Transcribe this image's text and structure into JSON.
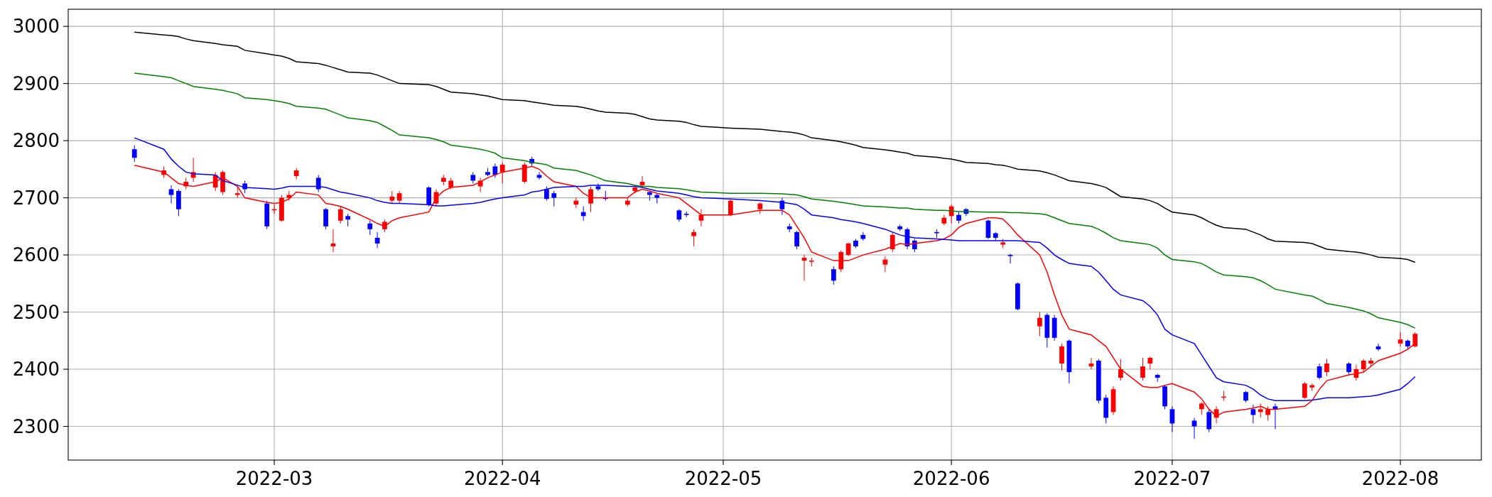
{
  "chart_data": {
    "type": "candlestick",
    "grid": true,
    "xlim": [
      "2022-02-01",
      "2022-08-12"
    ],
    "ylim": [
      2241,
      3030
    ],
    "xticks": [
      {
        "value": "2022-03-01",
        "label": "2022-03"
      },
      {
        "value": "2022-04-01",
        "label": "2022-04"
      },
      {
        "value": "2022-05-01",
        "label": "2022-05"
      },
      {
        "value": "2022-06-01",
        "label": "2022-06"
      },
      {
        "value": "2022-07-01",
        "label": "2022-07"
      },
      {
        "value": "2022-08-01",
        "label": "2022-08"
      }
    ],
    "yticks": [
      2300,
      2400,
      2500,
      2600,
      2700,
      2800,
      2900,
      3000
    ],
    "x": [
      "2022-02-10",
      "2022-02-14",
      "2022-02-15",
      "2022-02-16",
      "2022-02-17",
      "2022-02-18",
      "2022-02-21",
      "2022-02-22",
      "2022-02-24",
      "2022-02-25",
      "2022-02-28",
      "2022-03-01",
      "2022-03-02",
      "2022-03-03",
      "2022-03-04",
      "2022-03-07",
      "2022-03-08",
      "2022-03-09",
      "2022-03-10",
      "2022-03-11",
      "2022-03-14",
      "2022-03-15",
      "2022-03-16",
      "2022-03-17",
      "2022-03-18",
      "2022-03-22",
      "2022-03-23",
      "2022-03-24",
      "2022-03-25",
      "2022-03-28",
      "2022-03-29",
      "2022-03-30",
      "2022-03-31",
      "2022-04-01",
      "2022-04-04",
      "2022-04-05",
      "2022-04-06",
      "2022-04-07",
      "2022-04-08",
      "2022-04-11",
      "2022-04-12",
      "2022-04-13",
      "2022-04-14",
      "2022-04-15",
      "2022-04-18",
      "2022-04-19",
      "2022-04-20",
      "2022-04-21",
      "2022-04-22",
      "2022-04-25",
      "2022-04-26",
      "2022-04-27",
      "2022-04-28",
      "2022-05-02",
      "2022-05-06",
      "2022-05-09",
      "2022-05-10",
      "2022-05-11",
      "2022-05-12",
      "2022-05-13",
      "2022-05-16",
      "2022-05-17",
      "2022-05-18",
      "2022-05-19",
      "2022-05-20",
      "2022-05-23",
      "2022-05-24",
      "2022-05-25",
      "2022-05-26",
      "2022-05-27",
      "2022-05-30",
      "2022-05-31",
      "2022-06-01",
      "2022-06-02",
      "2022-06-03",
      "2022-06-06",
      "2022-06-07",
      "2022-06-08",
      "2022-06-09",
      "2022-06-10",
      "2022-06-13",
      "2022-06-14",
      "2022-06-15",
      "2022-06-16",
      "2022-06-17",
      "2022-06-20",
      "2022-06-21",
      "2022-06-22",
      "2022-06-23",
      "2022-06-24",
      "2022-06-27",
      "2022-06-28",
      "2022-06-29",
      "2022-06-30",
      "2022-07-01",
      "2022-07-04",
      "2022-07-05",
      "2022-07-06",
      "2022-07-07",
      "2022-07-08",
      "2022-07-11",
      "2022-07-12",
      "2022-07-13",
      "2022-07-14",
      "2022-07-15",
      "2022-07-19",
      "2022-07-20",
      "2022-07-21",
      "2022-07-22",
      "2022-07-25",
      "2022-07-26",
      "2022-07-27",
      "2022-07-28",
      "2022-07-29",
      "2022-08-01",
      "2022-08-02",
      "2022-08-03"
    ],
    "ohlc": [
      [
        2785,
        2792,
        2763,
        2770
      ],
      [
        2740,
        2755,
        2735,
        2748
      ],
      [
        2715,
        2722,
        2690,
        2705
      ],
      [
        2712,
        2715,
        2668,
        2680
      ],
      [
        2720,
        2735,
        2715,
        2728
      ],
      [
        2735,
        2770,
        2728,
        2745
      ],
      [
        2718,
        2745,
        2712,
        2740
      ],
      [
        2710,
        2748,
        2705,
        2745
      ],
      [
        2705,
        2718,
        2700,
        2708
      ],
      [
        2725,
        2730,
        2708,
        2715
      ],
      [
        2690,
        2695,
        2645,
        2650
      ],
      [
        2678,
        2688,
        2672,
        2680
      ],
      [
        2660,
        2705,
        2658,
        2700
      ],
      [
        2700,
        2712,
        2695,
        2705
      ],
      [
        2738,
        2752,
        2732,
        2748
      ],
      [
        2735,
        2740,
        2710,
        2715
      ],
      [
        2680,
        2682,
        2645,
        2650
      ],
      [
        2615,
        2645,
        2605,
        2620
      ],
      [
        2660,
        2685,
        2655,
        2680
      ],
      [
        2668,
        2672,
        2650,
        2662
      ],
      [
        2655,
        2660,
        2635,
        2645
      ],
      [
        2630,
        2640,
        2612,
        2620
      ],
      [
        2645,
        2662,
        2640,
        2658
      ],
      [
        2695,
        2712,
        2690,
        2702
      ],
      [
        2695,
        2712,
        2690,
        2708
      ],
      [
        2718,
        2720,
        2685,
        2688
      ],
      [
        2690,
        2715,
        2686,
        2710
      ],
      [
        2728,
        2740,
        2722,
        2735
      ],
      [
        2718,
        2735,
        2715,
        2730
      ],
      [
        2740,
        2745,
        2725,
        2730
      ],
      [
        2720,
        2735,
        2710,
        2730
      ],
      [
        2745,
        2752,
        2738,
        2740
      ],
      [
        2755,
        2760,
        2735,
        2740
      ],
      [
        2745,
        2762,
        2725,
        2758
      ],
      [
        2728,
        2762,
        2725,
        2758
      ],
      [
        2768,
        2772,
        2755,
        2760
      ],
      [
        2740,
        2745,
        2732,
        2735
      ],
      [
        2715,
        2720,
        2695,
        2698
      ],
      [
        2708,
        2712,
        2685,
        2700
      ],
      [
        2688,
        2700,
        2682,
        2695
      ],
      [
        2675,
        2685,
        2660,
        2668
      ],
      [
        2690,
        2720,
        2675,
        2715
      ],
      [
        2720,
        2725,
        2712,
        2715
      ],
      [
        2700,
        2712,
        2695,
        2698
      ],
      [
        2688,
        2700,
        2685,
        2695
      ],
      [
        2712,
        2722,
        2708,
        2718
      ],
      [
        2722,
        2738,
        2720,
        2728
      ],
      [
        2710,
        2712,
        2695,
        2705
      ],
      [
        2705,
        2708,
        2690,
        2700
      ],
      [
        2678,
        2680,
        2658,
        2662
      ],
      [
        2672,
        2676,
        2666,
        2670
      ],
      [
        2633,
        2645,
        2615,
        2640
      ],
      [
        2660,
        2680,
        2650,
        2670
      ],
      [
        2670,
        2698,
        2668,
        2695
      ],
      [
        2680,
        2692,
        2672,
        2690
      ],
      [
        2695,
        2700,
        2670,
        2680
      ],
      [
        2650,
        2655,
        2640,
        2645
      ],
      [
        2640,
        2642,
        2610,
        2615
      ],
      [
        2590,
        2600,
        2555,
        2595
      ],
      [
        2588,
        2595,
        2580,
        2590
      ],
      [
        2575,
        2580,
        2548,
        2555
      ],
      [
        2575,
        2608,
        2570,
        2605
      ],
      [
        2600,
        2622,
        2598,
        2620
      ],
      [
        2625,
        2628,
        2612,
        2615
      ],
      [
        2635,
        2640,
        2625,
        2628
      ],
      [
        2583,
        2598,
        2570,
        2592
      ],
      [
        2610,
        2640,
        2605,
        2635
      ],
      [
        2650,
        2653,
        2642,
        2645
      ],
      [
        2645,
        2648,
        2610,
        2615
      ],
      [
        2625,
        2628,
        2605,
        2610
      ],
      [
        2640,
        2645,
        2630,
        2638
      ],
      [
        2655,
        2670,
        2652,
        2665
      ],
      [
        2668,
        2688,
        2655,
        2685
      ],
      [
        2670,
        2675,
        2655,
        2660
      ],
      [
        2680,
        2682,
        2668,
        2672
      ],
      [
        2660,
        2662,
        2628,
        2630
      ],
      [
        2638,
        2640,
        2625,
        2630
      ],
      [
        2618,
        2628,
        2612,
        2622
      ],
      [
        2600,
        2602,
        2585,
        2598
      ],
      [
        2550,
        2552,
        2503,
        2505
      ],
      [
        2475,
        2500,
        2458,
        2490
      ],
      [
        2495,
        2498,
        2438,
        2455
      ],
      [
        2490,
        2495,
        2450,
        2455
      ],
      [
        2410,
        2445,
        2398,
        2440
      ],
      [
        2450,
        2452,
        2375,
        2395
      ],
      [
        2405,
        2420,
        2400,
        2410
      ],
      [
        2415,
        2418,
        2340,
        2345
      ],
      [
        2350,
        2355,
        2305,
        2315
      ],
      [
        2325,
        2370,
        2320,
        2365
      ],
      [
        2385,
        2418,
        2380,
        2400
      ],
      [
        2385,
        2420,
        2380,
        2405
      ],
      [
        2410,
        2422,
        2400,
        2420
      ],
      [
        2390,
        2392,
        2378,
        2385
      ],
      [
        2370,
        2372,
        2330,
        2335
      ],
      [
        2330,
        2335,
        2290,
        2305
      ],
      [
        2310,
        2315,
        2278,
        2300
      ],
      [
        2330,
        2342,
        2320,
        2340
      ],
      [
        2325,
        2330,
        2290,
        2295
      ],
      [
        2315,
        2335,
        2305,
        2330
      ],
      [
        2350,
        2362,
        2345,
        2352
      ],
      [
        2360,
        2362,
        2342,
        2345
      ],
      [
        2330,
        2338,
        2305,
        2320
      ],
      [
        2325,
        2340,
        2315,
        2330
      ],
      [
        2320,
        2335,
        2310,
        2330
      ],
      [
        2335,
        2340,
        2295,
        2330
      ],
      [
        2350,
        2378,
        2348,
        2375
      ],
      [
        2368,
        2375,
        2362,
        2372
      ],
      [
        2405,
        2410,
        2382,
        2385
      ],
      [
        2395,
        2418,
        2388,
        2410
      ],
      [
        2410,
        2412,
        2390,
        2395
      ],
      [
        2385,
        2408,
        2380,
        2400
      ],
      [
        2400,
        2418,
        2395,
        2415
      ],
      [
        2410,
        2420,
        2405,
        2415
      ],
      [
        2440,
        2445,
        2432,
        2435
      ],
      [
        2445,
        2465,
        2440,
        2452
      ],
      [
        2450,
        2452,
        2435,
        2440
      ],
      [
        2440,
        2465,
        2438,
        2462
      ]
    ],
    "series": [
      {
        "type": "line",
        "color": "#ff0000",
        "values": [
          2757,
          2745,
          2735,
          2725,
          2722,
          2720,
          2728,
          2735,
          2720,
          2700,
          2692,
          2690,
          2692,
          2698,
          2710,
          2705,
          2690,
          2688,
          2685,
          2680,
          2662,
          2655,
          2650,
          2660,
          2665,
          2675,
          2700,
          2712,
          2718,
          2722,
          2728,
          2735,
          2740,
          2745,
          2752,
          2755,
          2750,
          2738,
          2728,
          2720,
          2708,
          2700,
          2700,
          2700,
          2700,
          2710,
          2715,
          2712,
          2708,
          2700,
          2690,
          2680,
          2670,
          2670,
          2678,
          2678,
          2670,
          2650,
          2630,
          2605,
          2590,
          2590,
          2590,
          2595,
          2600,
          2610,
          2615,
          2620,
          2618,
          2620,
          2625,
          2628,
          2635,
          2648,
          2655,
          2665,
          2665,
          2663,
          2650,
          2635,
          2600,
          2570,
          2530,
          2495,
          2470,
          2460,
          2450,
          2440,
          2420,
          2400,
          2370,
          2368,
          2368,
          2372,
          2375,
          2360,
          2348,
          2330,
          2318,
          2325,
          2330,
          2332,
          2335,
          2330,
          2330,
          2335,
          2345,
          2365,
          2380,
          2390,
          2392,
          2395,
          2405,
          2415,
          2428,
          2435,
          2445
        ]
      },
      {
        "type": "line",
        "color": "#0000ff",
        "values": [
          2805,
          2785,
          2768,
          2755,
          2745,
          2742,
          2740,
          2730,
          2722,
          2718,
          2716,
          2715,
          2717,
          2720,
          2720,
          2720,
          2718,
          2714,
          2710,
          2708,
          2700,
          2695,
          2692,
          2690,
          2690,
          2688,
          2686,
          2686,
          2687,
          2690,
          2692,
          2695,
          2698,
          2700,
          2705,
          2710,
          2712,
          2715,
          2718,
          2720,
          2720,
          2722,
          2722,
          2722,
          2720,
          2720,
          2718,
          2715,
          2712,
          2708,
          2705,
          2702,
          2700,
          2698,
          2695,
          2692,
          2690,
          2688,
          2680,
          2670,
          2665,
          2662,
          2660,
          2658,
          2655,
          2645,
          2640,
          2635,
          2632,
          2630,
          2628,
          2627,
          2626,
          2625,
          2625,
          2625,
          2625,
          2625,
          2625,
          2625,
          2622,
          2612,
          2600,
          2592,
          2585,
          2580,
          2570,
          2555,
          2540,
          2530,
          2520,
          2510,
          2495,
          2470,
          2460,
          2445,
          2425,
          2405,
          2385,
          2378,
          2372,
          2365,
          2355,
          2348,
          2345,
          2345,
          2346,
          2348,
          2350,
          2350,
          2351,
          2352,
          2353,
          2355,
          2365,
          2375,
          2387
        ]
      },
      {
        "type": "line",
        "color": "#008000",
        "values": [
          2918,
          2912,
          2910,
          2905,
          2900,
          2895,
          2890,
          2888,
          2882,
          2875,
          2872,
          2870,
          2868,
          2865,
          2860,
          2857,
          2855,
          2850,
          2845,
          2840,
          2835,
          2832,
          2825,
          2818,
          2810,
          2805,
          2802,
          2798,
          2792,
          2787,
          2785,
          2782,
          2778,
          2770,
          2765,
          2762,
          2760,
          2758,
          2752,
          2748,
          2744,
          2740,
          2735,
          2730,
          2725,
          2722,
          2720,
          2720,
          2718,
          2716,
          2714,
          2712,
          2710,
          2708,
          2708,
          2707,
          2706,
          2705,
          2702,
          2698,
          2694,
          2692,
          2690,
          2688,
          2686,
          2684,
          2683,
          2682,
          2682,
          2680,
          2678,
          2678,
          2677,
          2676,
          2676,
          2675,
          2675,
          2675,
          2674,
          2674,
          2672,
          2670,
          2665,
          2660,
          2655,
          2650,
          2645,
          2638,
          2630,
          2625,
          2620,
          2618,
          2612,
          2600,
          2592,
          2588,
          2585,
          2578,
          2570,
          2565,
          2562,
          2560,
          2555,
          2548,
          2540,
          2530,
          2528,
          2522,
          2515,
          2508,
          2505,
          2502,
          2497,
          2490,
          2482,
          2478,
          2472
        ]
      },
      {
        "type": "line",
        "color": "#000000",
        "values": [
          2990,
          2985,
          2984,
          2982,
          2978,
          2975,
          2970,
          2968,
          2965,
          2958,
          2952,
          2950,
          2948,
          2944,
          2938,
          2935,
          2932,
          2928,
          2924,
          2920,
          2918,
          2915,
          2910,
          2905,
          2900,
          2898,
          2895,
          2890,
          2885,
          2882,
          2880,
          2878,
          2875,
          2872,
          2870,
          2868,
          2866,
          2864,
          2862,
          2860,
          2858,
          2855,
          2852,
          2850,
          2848,
          2846,
          2842,
          2838,
          2836,
          2834,
          2832,
          2828,
          2825,
          2822,
          2820,
          2816,
          2815,
          2813,
          2810,
          2805,
          2800,
          2798,
          2795,
          2792,
          2788,
          2784,
          2782,
          2780,
          2778,
          2774,
          2771,
          2769,
          2768,
          2765,
          2762,
          2760,
          2758,
          2757,
          2754,
          2750,
          2747,
          2744,
          2740,
          2735,
          2730,
          2725,
          2722,
          2718,
          2710,
          2702,
          2698,
          2695,
          2690,
          2682,
          2675,
          2670,
          2665,
          2658,
          2652,
          2648,
          2645,
          2640,
          2635,
          2628,
          2624,
          2622,
          2620,
          2615,
          2610,
          2606,
          2605,
          2603,
          2600,
          2596,
          2594,
          2592,
          2587
        ]
      }
    ]
  }
}
